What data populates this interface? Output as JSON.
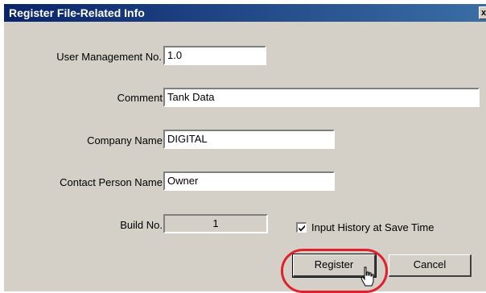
{
  "window": {
    "title": "Register File-Related Info",
    "close_glyph": "x"
  },
  "form": {
    "user_management_no": {
      "label": "User Management No.",
      "value": "1.0"
    },
    "comment": {
      "label": "Comment",
      "value": "Tank Data"
    },
    "company_name": {
      "label": "Company Name",
      "value": "DIGITAL"
    },
    "contact_person_name": {
      "label": "Contact Person Name",
      "value": "Owner"
    },
    "build_no": {
      "label": "Build No.",
      "value": "1"
    },
    "input_history": {
      "label": "Input History at Save Time",
      "checked": true
    }
  },
  "buttons": {
    "register": "Register",
    "cancel": "Cancel"
  },
  "colors": {
    "title_start": "#0a246a",
    "title_end": "#3a6ea5",
    "dialog_bg": "#d4d0c8",
    "highlight": "#e0202a"
  },
  "icons": {
    "close": "close-icon",
    "checkbox": "check-icon",
    "cursor": "hand-pointer-icon"
  }
}
